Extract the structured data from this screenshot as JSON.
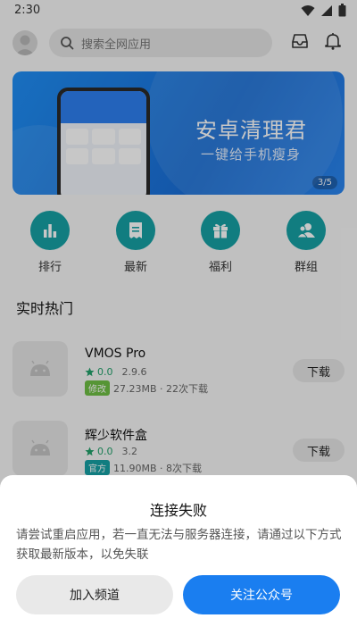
{
  "status": {
    "time": "2:30"
  },
  "search": {
    "placeholder": "搜索全网应用"
  },
  "banner": {
    "title": "安卓清理君",
    "subtitle": "一键给手机瘦身",
    "indicator": "3/5"
  },
  "quick_nav": [
    {
      "label": "排行",
      "icon": "bar-chart-icon"
    },
    {
      "label": "最新",
      "icon": "receipt-icon"
    },
    {
      "label": "福利",
      "icon": "gift-icon"
    },
    {
      "label": "群组",
      "icon": "group-icon"
    }
  ],
  "section": {
    "title": "实时热门"
  },
  "apps": [
    {
      "name": "VMOS Pro",
      "rating": "0.0",
      "version": "2.9.6",
      "tag": "修改",
      "tag_color": "#6fbf45",
      "info": "27.23MB · 22次下载",
      "button": "下载"
    },
    {
      "name": "辉少软件盒",
      "rating": "0.0",
      "version": "3.2",
      "tag": "官方",
      "tag_color": "#17a0a4",
      "info": "11.90MB · 8次下载",
      "button": "下载"
    }
  ],
  "dialog": {
    "title": "连接失败",
    "message": "请尝试重启应用，若一直无法与服务器连接，请通过以下方式获取最新版本，以免失联",
    "left_button": "加入频道",
    "right_button": "关注公众号"
  },
  "colors": {
    "accent": "#1a7ef0",
    "teal": "#17a0a4"
  }
}
